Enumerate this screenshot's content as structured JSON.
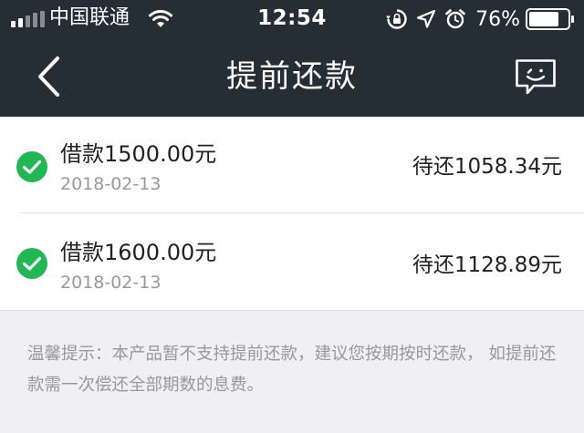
{
  "status_bar": {
    "carrier": "中国联通",
    "time": "12:54",
    "battery_percent": "76%",
    "icons": [
      "signal-icon",
      "wifi-icon",
      "rotation-lock-icon",
      "location-icon",
      "alarm-icon",
      "battery-icon"
    ]
  },
  "nav": {
    "title": "提前还款",
    "back_icon": "chevron-left-icon",
    "feedback_icon": "feedback-chat-icon"
  },
  "loans": [
    {
      "title": "借款1500.00元",
      "date": "2018-02-13",
      "due": "待还1058.34元",
      "selected": true
    },
    {
      "title": "借款1600.00元",
      "date": "2018-02-13",
      "due": "待还1128.89元",
      "selected": true
    }
  ],
  "tip": "温馨提示：本产品暂不支持提前还款，建议您按期按时还款， 如提前还款需一次偿还全部期数的息费。",
  "colors": {
    "header_bg": "#252e35",
    "check_green": "#1fb854",
    "page_bg": "#efeff4"
  }
}
